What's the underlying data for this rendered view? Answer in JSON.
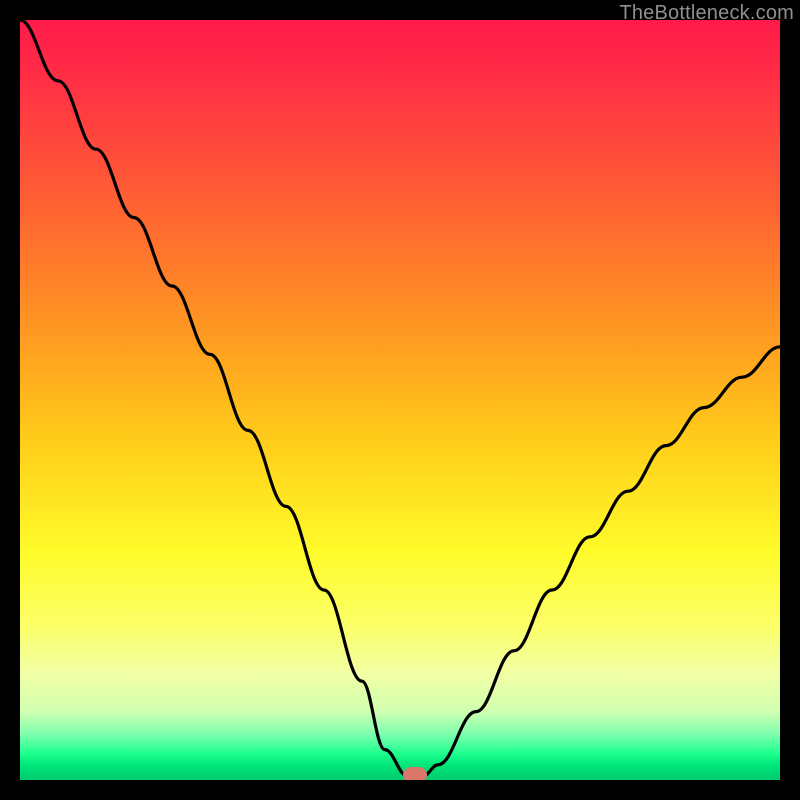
{
  "watermark": "TheBottleneck.com",
  "chart_data": {
    "type": "line",
    "title": "",
    "xlabel": "",
    "ylabel": "",
    "xlim": [
      0,
      100
    ],
    "ylim": [
      0,
      100
    ],
    "grid": false,
    "legend": false,
    "series": [
      {
        "name": "bottleneck-curve",
        "x": [
          0,
          5,
          10,
          15,
          20,
          25,
          30,
          35,
          40,
          45,
          48,
          51,
          53,
          55,
          60,
          65,
          70,
          75,
          80,
          85,
          90,
          95,
          100
        ],
        "y": [
          100,
          92,
          83,
          74,
          65,
          56,
          46,
          36,
          25,
          13,
          4,
          0.5,
          0.5,
          2,
          9,
          17,
          25,
          32,
          38,
          44,
          49,
          53,
          57
        ]
      }
    ],
    "marker": {
      "x": 52,
      "y": 0.6
    },
    "background_gradient": {
      "direction": "vertical",
      "stops": [
        {
          "pos": 0.0,
          "color": "#ff1a4a"
        },
        {
          "pos": 0.2,
          "color": "#ff5438"
        },
        {
          "pos": 0.44,
          "color": "#ffa31f"
        },
        {
          "pos": 0.7,
          "color": "#fffb2a"
        },
        {
          "pos": 0.92,
          "color": "#b8ffb0"
        },
        {
          "pos": 1.0,
          "color": "#00cc6e"
        }
      ]
    }
  }
}
